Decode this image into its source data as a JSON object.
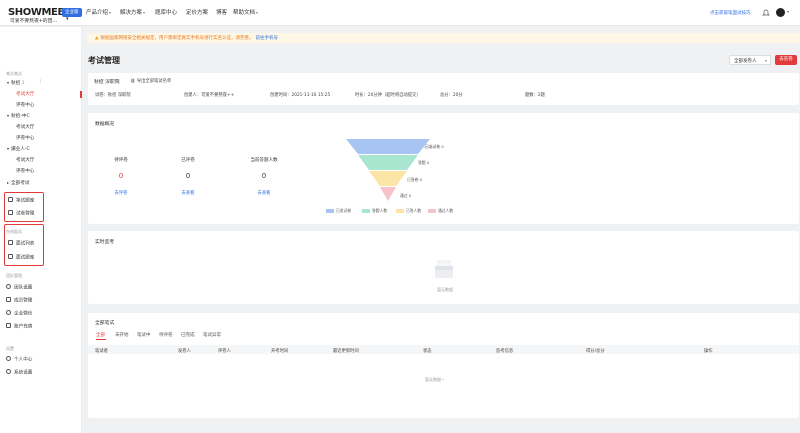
{
  "topbar": {
    "logo": "SHOWMEBUG",
    "badge": "企业版",
    "nav": [
      "产品介绍",
      "解决方案",
      "题库中心",
      "定价方案",
      "博客",
      "帮助文档"
    ],
    "right_link": "点击获取笔面试技巧"
  },
  "sidebar": {
    "team": "可爱不要熬夜+的团...",
    "sec_written": "笔试笔试",
    "groups": [
      {
        "name": "秋招",
        "count": "1"
      },
      {
        "name": "秋招-中C"
      },
      {
        "name": "讀业人-C"
      }
    ],
    "sub_items": [
      "考试大厅",
      "评卷中心"
    ],
    "all_exams": "全部考试",
    "written_items": [
      "笔试题库",
      "试卷管理"
    ],
    "sec_interview": "在线面试",
    "interview_items": [
      "面试列表",
      "面试题库"
    ],
    "sec_team": "团队管理",
    "team_items": [
      "团队设置",
      "成员管理",
      "企业微信",
      "账户充值"
    ],
    "sec_settings": "设置",
    "settings_items": [
      "个人中心",
      "系统设置"
    ]
  },
  "notice": {
    "text": "根据国家网络安全相关规定，用户需绑定真实手机号进行实名认证，请完善。",
    "link": "前往手机号"
  },
  "header": {
    "title": "考试管理",
    "select": "全部发卷人",
    "button": "去答卷"
  },
  "exam": {
    "name": "秋招 深职院",
    "export_link": "导出全部笔试名单",
    "meta": [
      {
        "k": "试卷：",
        "v": "秋招 深职院"
      },
      {
        "k": "创建人：",
        "v": "可爱不要熬夜++"
      },
      {
        "k": "创建时间：",
        "v": "2021-11-16 15:25"
      },
      {
        "k": "时长：",
        "v": "20分钟（超时将自动提交）"
      },
      {
        "k": "总分：",
        "v": "20分"
      },
      {
        "k": "题数：",
        "v": "2题"
      }
    ]
  },
  "overview": {
    "title": "数据概况",
    "stats": [
      {
        "label": "待评卷",
        "value": "0",
        "action": "去评卷"
      },
      {
        "label": "已评卷",
        "value": "0",
        "action": "去查看"
      },
      {
        "label": "当前答题人数",
        "value": "0",
        "action": "去查看"
      }
    ],
    "funnel": [
      "已发试卷 0",
      "答题 0",
      "已答卷 0",
      "通过 0"
    ],
    "legend": [
      "已发试卷",
      "答题人数",
      "已答人数",
      "通过人数"
    ]
  },
  "monitor": {
    "title": "实时监考",
    "empty": "暂无数据"
  },
  "table": {
    "title": "全部笔试",
    "tabs": [
      "全部",
      "未开始",
      "笔试中",
      "待评卷",
      "已完成",
      "笔试异常"
    ],
    "columns": [
      "笔试者",
      "发卷人",
      "评卷人",
      "开考时间",
      "最近更新时间",
      "状态",
      "监考信息",
      "得分/总分",
      "操作"
    ],
    "empty": "暂无数据~"
  },
  "colors": {
    "accent": "#e23b3b",
    "link": "#2f6fe0",
    "funnel": [
      "#a8c4f2",
      "#a8e6d0",
      "#fbe6a8",
      "#f6c4c8"
    ]
  }
}
